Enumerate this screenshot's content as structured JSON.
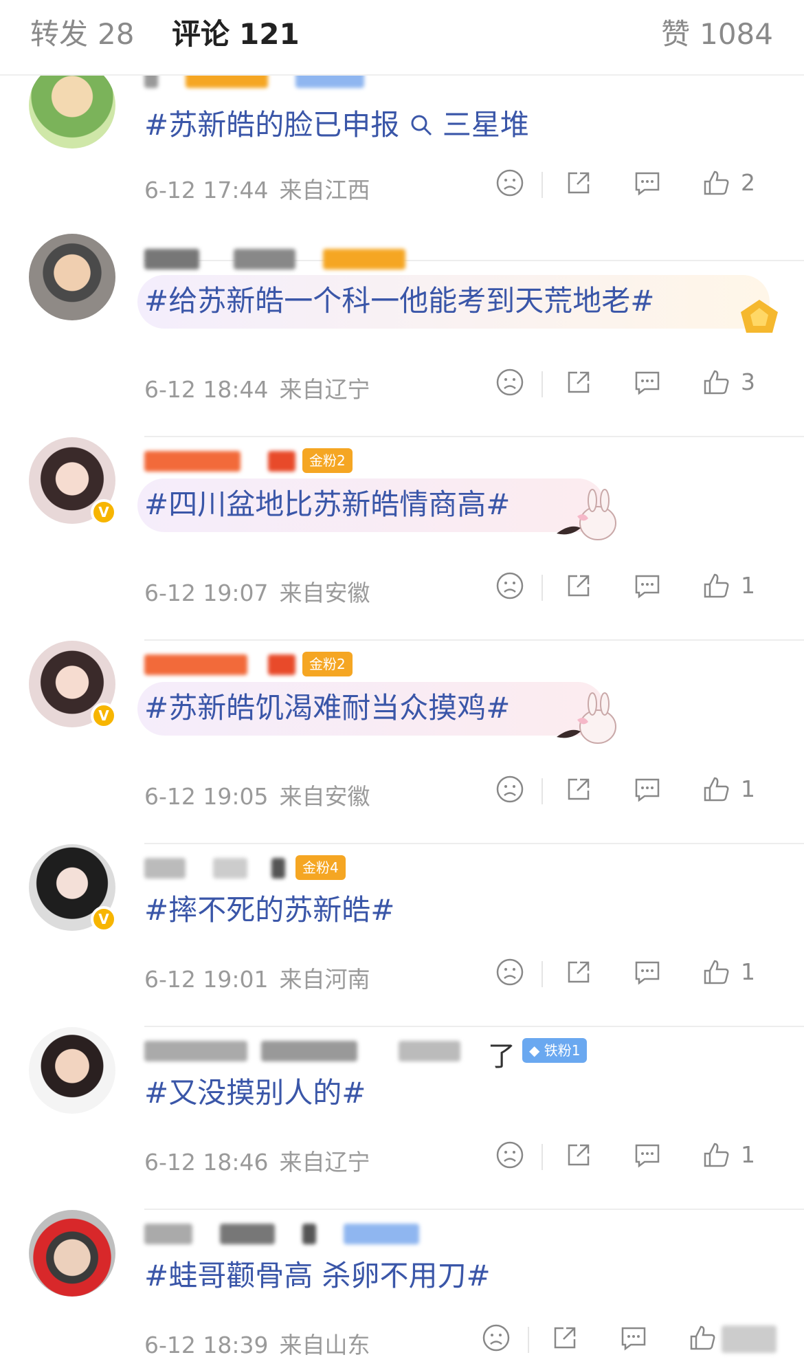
{
  "tabs": {
    "repost": {
      "label": "转发",
      "count": "28"
    },
    "comments": {
      "label": "评论",
      "count": "121"
    },
    "likes": {
      "label": "赞",
      "count": "1084"
    }
  },
  "colors": {
    "topic_link": "#3a56a8",
    "meta": "#9a9a9a",
    "gold_badge": "#f5a623",
    "iron_badge": "#6aa8f0"
  },
  "comments": [
    {
      "text_before": "#苏新皓的脸已申报",
      "search_icon": "search-icon",
      "text_after": "三星堆",
      "time": "6-12 17:44",
      "location": "来自江西",
      "likes": "2"
    },
    {
      "text": "#给苏新皓一个科一他能考到天荒地老#",
      "time": "6-12 18:44",
      "location": "来自辽宁",
      "likes": "3"
    },
    {
      "text": "#四川盆地比苏新皓情商高#",
      "badge": "金粉2",
      "time": "6-12 19:07",
      "location": "来自安徽",
      "likes": "1"
    },
    {
      "text": "#苏新皓饥渴难耐当众摸鸡#",
      "badge": "金粉2",
      "time": "6-12 19:05",
      "location": "来自安徽",
      "likes": "1"
    },
    {
      "text": "#摔不死的苏新皓#",
      "badge": "金粉4",
      "time": "6-12 19:01",
      "location": "来自河南",
      "likes": "1"
    },
    {
      "name_visible": "了",
      "badge": "铁粉1",
      "text": "#又没摸别人的#",
      "time": "6-12 18:46",
      "location": "来自辽宁",
      "likes": "1"
    },
    {
      "text": "#蛙哥颧骨高 杀卵不用刀#",
      "time": "6-12 18:39",
      "location": "来自山东",
      "likes": ""
    }
  ]
}
